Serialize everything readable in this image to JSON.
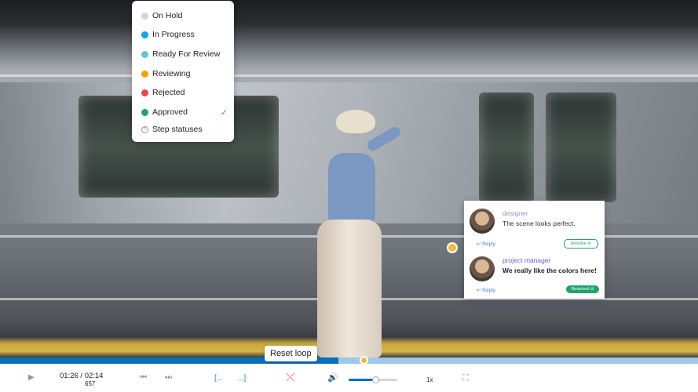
{
  "status_menu": {
    "items": [
      {
        "label": "On Hold",
        "color": "#d1d5db"
      },
      {
        "label": "In Progress",
        "color": "#0ea5e9"
      },
      {
        "label": "Ready For Review",
        "color": "#5bc8d8"
      },
      {
        "label": "Reviewing",
        "color": "#f59e0b"
      },
      {
        "label": "Rejected",
        "color": "#ef4444"
      },
      {
        "label": "Approved",
        "color": "#22a36a",
        "checked": true
      }
    ],
    "step_statuses_label": "Step statuses",
    "check_mark": "✓",
    "help_mark": "?"
  },
  "comments": [
    {
      "author": "designer",
      "author_color": "#9b8fcc",
      "text": "The scene looks perfect.",
      "reply": "Reply",
      "resolve": "Resolve",
      "resolved": false
    },
    {
      "author": "project manager",
      "author_color": "#6d5bd0",
      "text": "We really like the colors here!",
      "reply": "Reply",
      "resolve": "Resolved",
      "resolved": true
    }
  ],
  "tooltip": "Reset loop",
  "player": {
    "time": "01:26 / 02:14",
    "frame": "657",
    "speed": "1x",
    "progress": 0.485,
    "volume": 0.58
  },
  "icons": {
    "play": "▶",
    "prev": "⏮",
    "next": "⏭",
    "loop_start": "[...",
    "loop_end": "...]",
    "reset_loop": "⤬",
    "volume": "🔊",
    "fullscreen": "⛶",
    "reply": "↩"
  }
}
